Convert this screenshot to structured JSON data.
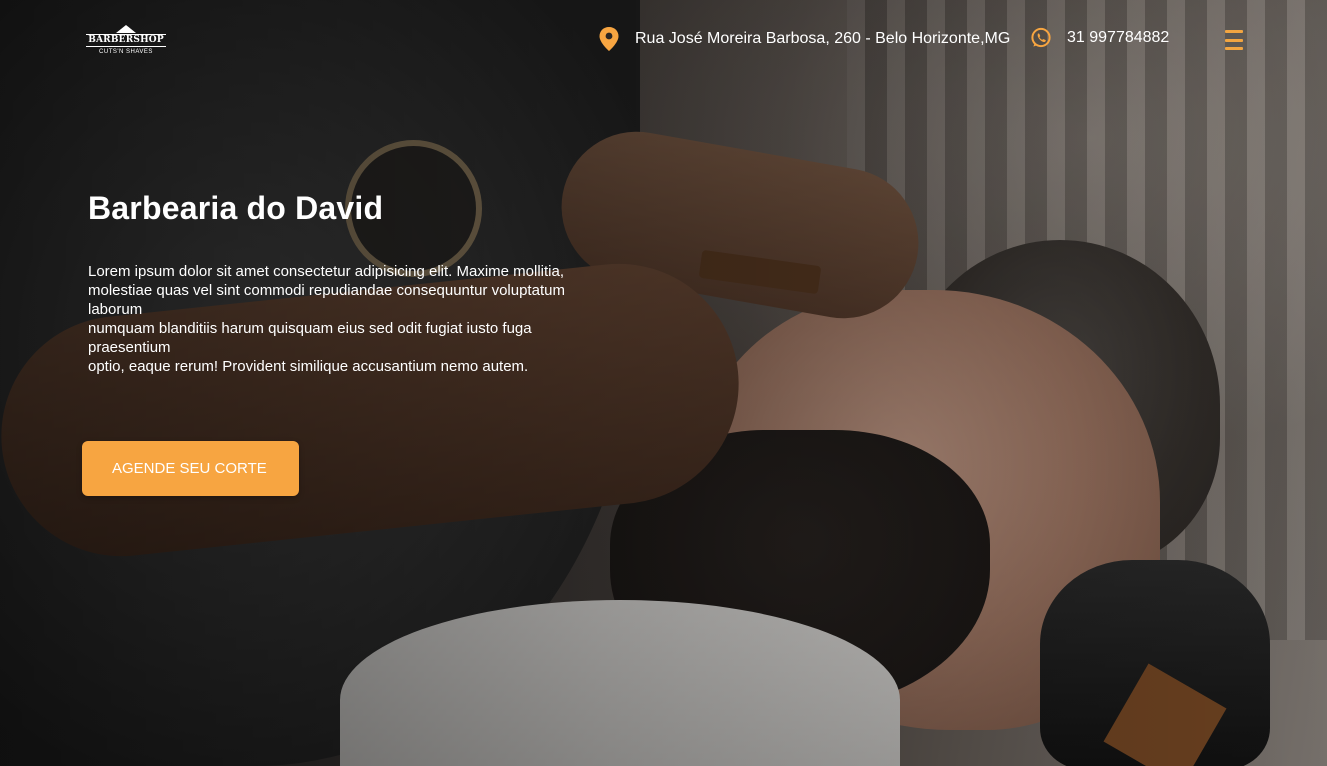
{
  "brand": {
    "logo_title": "BARBERSHOP",
    "logo_subtitle": "CUTS'N SHAVES"
  },
  "header": {
    "address": "Rua José Moreira Barbosa, 260 - Belo Horizonte,MG",
    "phone": "31 997784882",
    "icons": {
      "address": "map-pin-icon",
      "phone": "whatsapp-icon",
      "menu": "hamburger-menu-icon"
    }
  },
  "hero": {
    "title": "Barbearia do David",
    "description_lines": [
      "Lorem ipsum dolor sit amet consectetur adipisicing elit. Maxime mollitia,",
      "molestiae quas vel sint commodi repudiandae consequuntur voluptatum laborum",
      "numquam blanditiis harum quisquam eius sed odit fugiat iusto fuga praesentium",
      "optio, eaque rerum! Provident similique accusantium nemo autem."
    ],
    "cta_label": "AGENDE SEU CORTE"
  },
  "colors": {
    "accent": "#f7a541",
    "text": "#ffffff"
  }
}
